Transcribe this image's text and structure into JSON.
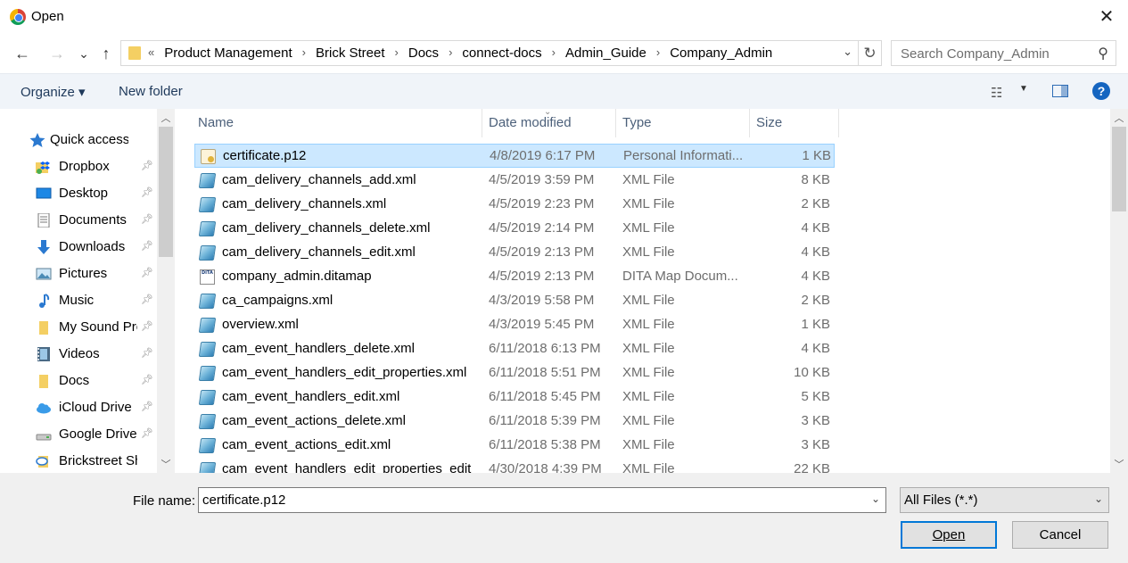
{
  "window": {
    "title": "Open",
    "app_icon": "chrome-icon"
  },
  "nav": {
    "back": "←",
    "forward": "→",
    "recent": "⌄",
    "up": "↑",
    "breadcrumb_overflow": "«",
    "breadcrumbs": [
      "Product Management",
      "Brick Street",
      "Docs",
      "connect-docs",
      "Admin_Guide",
      "Company_Admin"
    ],
    "search_placeholder": "Search Company_Admin"
  },
  "toolbar": {
    "organize": "Organize ▾",
    "new_folder": "New folder",
    "help": "?"
  },
  "sidebar": {
    "quick_access": "Quick access",
    "items": [
      {
        "label": "Dropbox",
        "icon": "dropbox-icon",
        "pinned": true
      },
      {
        "label": "Desktop",
        "icon": "desktop-icon",
        "pinned": true
      },
      {
        "label": "Documents",
        "icon": "documents-icon",
        "pinned": true
      },
      {
        "label": "Downloads",
        "icon": "downloads-icon",
        "pinned": true
      },
      {
        "label": "Pictures",
        "icon": "pictures-icon",
        "pinned": true
      },
      {
        "label": "Music",
        "icon": "music-icon",
        "pinned": true
      },
      {
        "label": "My Sound Pro",
        "icon": "folder-icon",
        "pinned": true
      },
      {
        "label": "Videos",
        "icon": "videos-icon",
        "pinned": true
      },
      {
        "label": "Docs",
        "icon": "folder-icon",
        "pinned": true
      },
      {
        "label": "iCloud Drive",
        "icon": "icloud-icon",
        "pinned": true
      },
      {
        "label": "Google Drive",
        "icon": "drive-icon",
        "pinned": true
      },
      {
        "label": "Brickstreet Sh",
        "icon": "sharepoint-icon",
        "pinned": false
      }
    ]
  },
  "columns": {
    "name": "Name",
    "date": "Date modified",
    "type": "Type",
    "size": "Size"
  },
  "files": [
    {
      "name": "certificate.p12",
      "date": "4/8/2019 6:17 PM",
      "type": "Personal Informati...",
      "size": "1 KB",
      "icon": "certificate-icon",
      "selected": true
    },
    {
      "name": "cam_delivery_channels_add.xml",
      "date": "4/5/2019 3:59 PM",
      "type": "XML File",
      "size": "8 KB",
      "icon": "xml-file-icon"
    },
    {
      "name": "cam_delivery_channels.xml",
      "date": "4/5/2019 2:23 PM",
      "type": "XML File",
      "size": "2 KB",
      "icon": "xml-file-icon"
    },
    {
      "name": "cam_delivery_channels_delete.xml",
      "date": "4/5/2019 2:14 PM",
      "type": "XML File",
      "size": "4 KB",
      "icon": "xml-file-icon"
    },
    {
      "name": "cam_delivery_channels_edit.xml",
      "date": "4/5/2019 2:13 PM",
      "type": "XML File",
      "size": "4 KB",
      "icon": "xml-file-icon"
    },
    {
      "name": "company_admin.ditamap",
      "date": "4/5/2019 2:13 PM",
      "type": "DITA Map Docum...",
      "size": "4 KB",
      "icon": "ditamap-file-icon"
    },
    {
      "name": "ca_campaigns.xml",
      "date": "4/3/2019 5:58 PM",
      "type": "XML File",
      "size": "2 KB",
      "icon": "xml-file-icon"
    },
    {
      "name": "overview.xml",
      "date": "4/3/2019 5:45 PM",
      "type": "XML File",
      "size": "1 KB",
      "icon": "xml-file-icon"
    },
    {
      "name": "cam_event_handlers_delete.xml",
      "date": "6/11/2018 6:13 PM",
      "type": "XML File",
      "size": "4 KB",
      "icon": "xml-file-icon"
    },
    {
      "name": "cam_event_handlers_edit_properties.xml",
      "date": "6/11/2018 5:51 PM",
      "type": "XML File",
      "size": "10 KB",
      "icon": "xml-file-icon"
    },
    {
      "name": "cam_event_handlers_edit.xml",
      "date": "6/11/2018 5:45 PM",
      "type": "XML File",
      "size": "5 KB",
      "icon": "xml-file-icon"
    },
    {
      "name": "cam_event_actions_delete.xml",
      "date": "6/11/2018 5:39 PM",
      "type": "XML File",
      "size": "3 KB",
      "icon": "xml-file-icon"
    },
    {
      "name": "cam_event_actions_edit.xml",
      "date": "6/11/2018 5:38 PM",
      "type": "XML File",
      "size": "3 KB",
      "icon": "xml-file-icon"
    },
    {
      "name": "cam_event_handlers_edit_properties_edit",
      "date": "4/30/2018 4:39 PM",
      "type": "XML File",
      "size": "22 KB",
      "icon": "xml-file-icon"
    }
  ],
  "bottom": {
    "file_name_label": "File name:",
    "file_name_value": "certificate.p12",
    "filter_value": "All Files (*.*)",
    "open": "Open",
    "cancel": "Cancel"
  }
}
